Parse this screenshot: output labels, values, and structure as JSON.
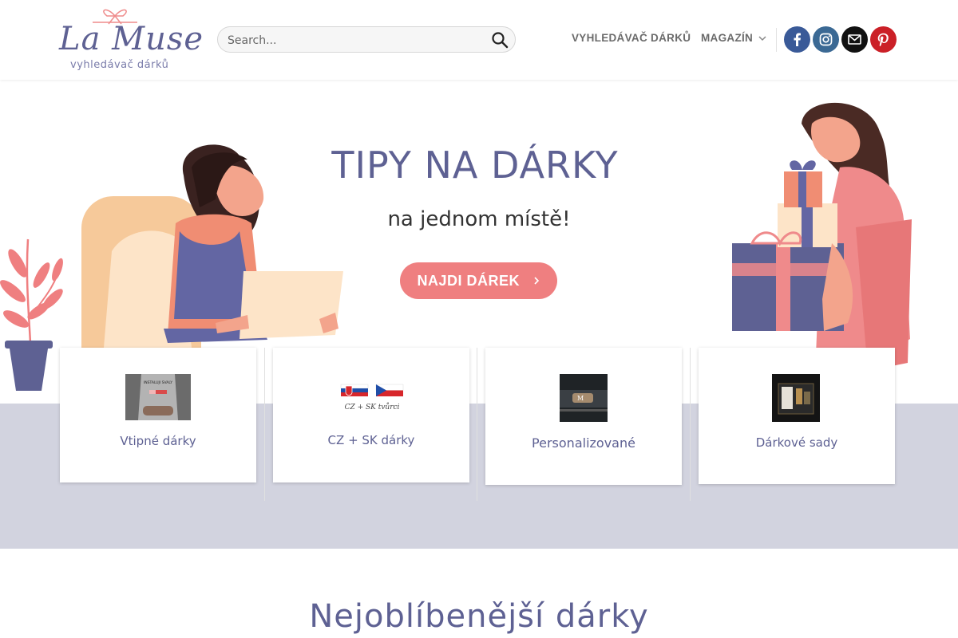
{
  "header": {
    "logo_text": "La Muse",
    "logo_subtitle": "vyhledávač dárků",
    "search_placeholder": "Search...",
    "nav": [
      {
        "label": "VYHLEDÁVAČ DÁRKŮ"
      },
      {
        "label": "MAGAZÍN"
      }
    ],
    "social": [
      {
        "icon": "facebook-icon",
        "color": "#3a5a98"
      },
      {
        "icon": "instagram-icon",
        "color": "#3b6994"
      },
      {
        "icon": "email-icon",
        "color": "#111111"
      },
      {
        "icon": "pinterest-icon",
        "color": "#cb2027"
      }
    ]
  },
  "hero": {
    "title": "TIPY NA DÁRKY",
    "subtitle": "na jednom místě!",
    "cta_label": "NAJDI DÁREK",
    "cta_color": "#ef7f80"
  },
  "categories": [
    {
      "label": "Vtipné dárky",
      "image_text": "INSTALUJI SVALY"
    },
    {
      "label": "CZ + SK dárky",
      "image_text": "CZ + SK tvůrci"
    },
    {
      "label": "Personalizované"
    },
    {
      "label": "Dárkové sady"
    }
  ],
  "section": {
    "title": "Nejoblíbenější dárky"
  },
  "colors": {
    "brand": "#5e6193",
    "accent": "#ef7f80",
    "band": "#d2d3df"
  }
}
